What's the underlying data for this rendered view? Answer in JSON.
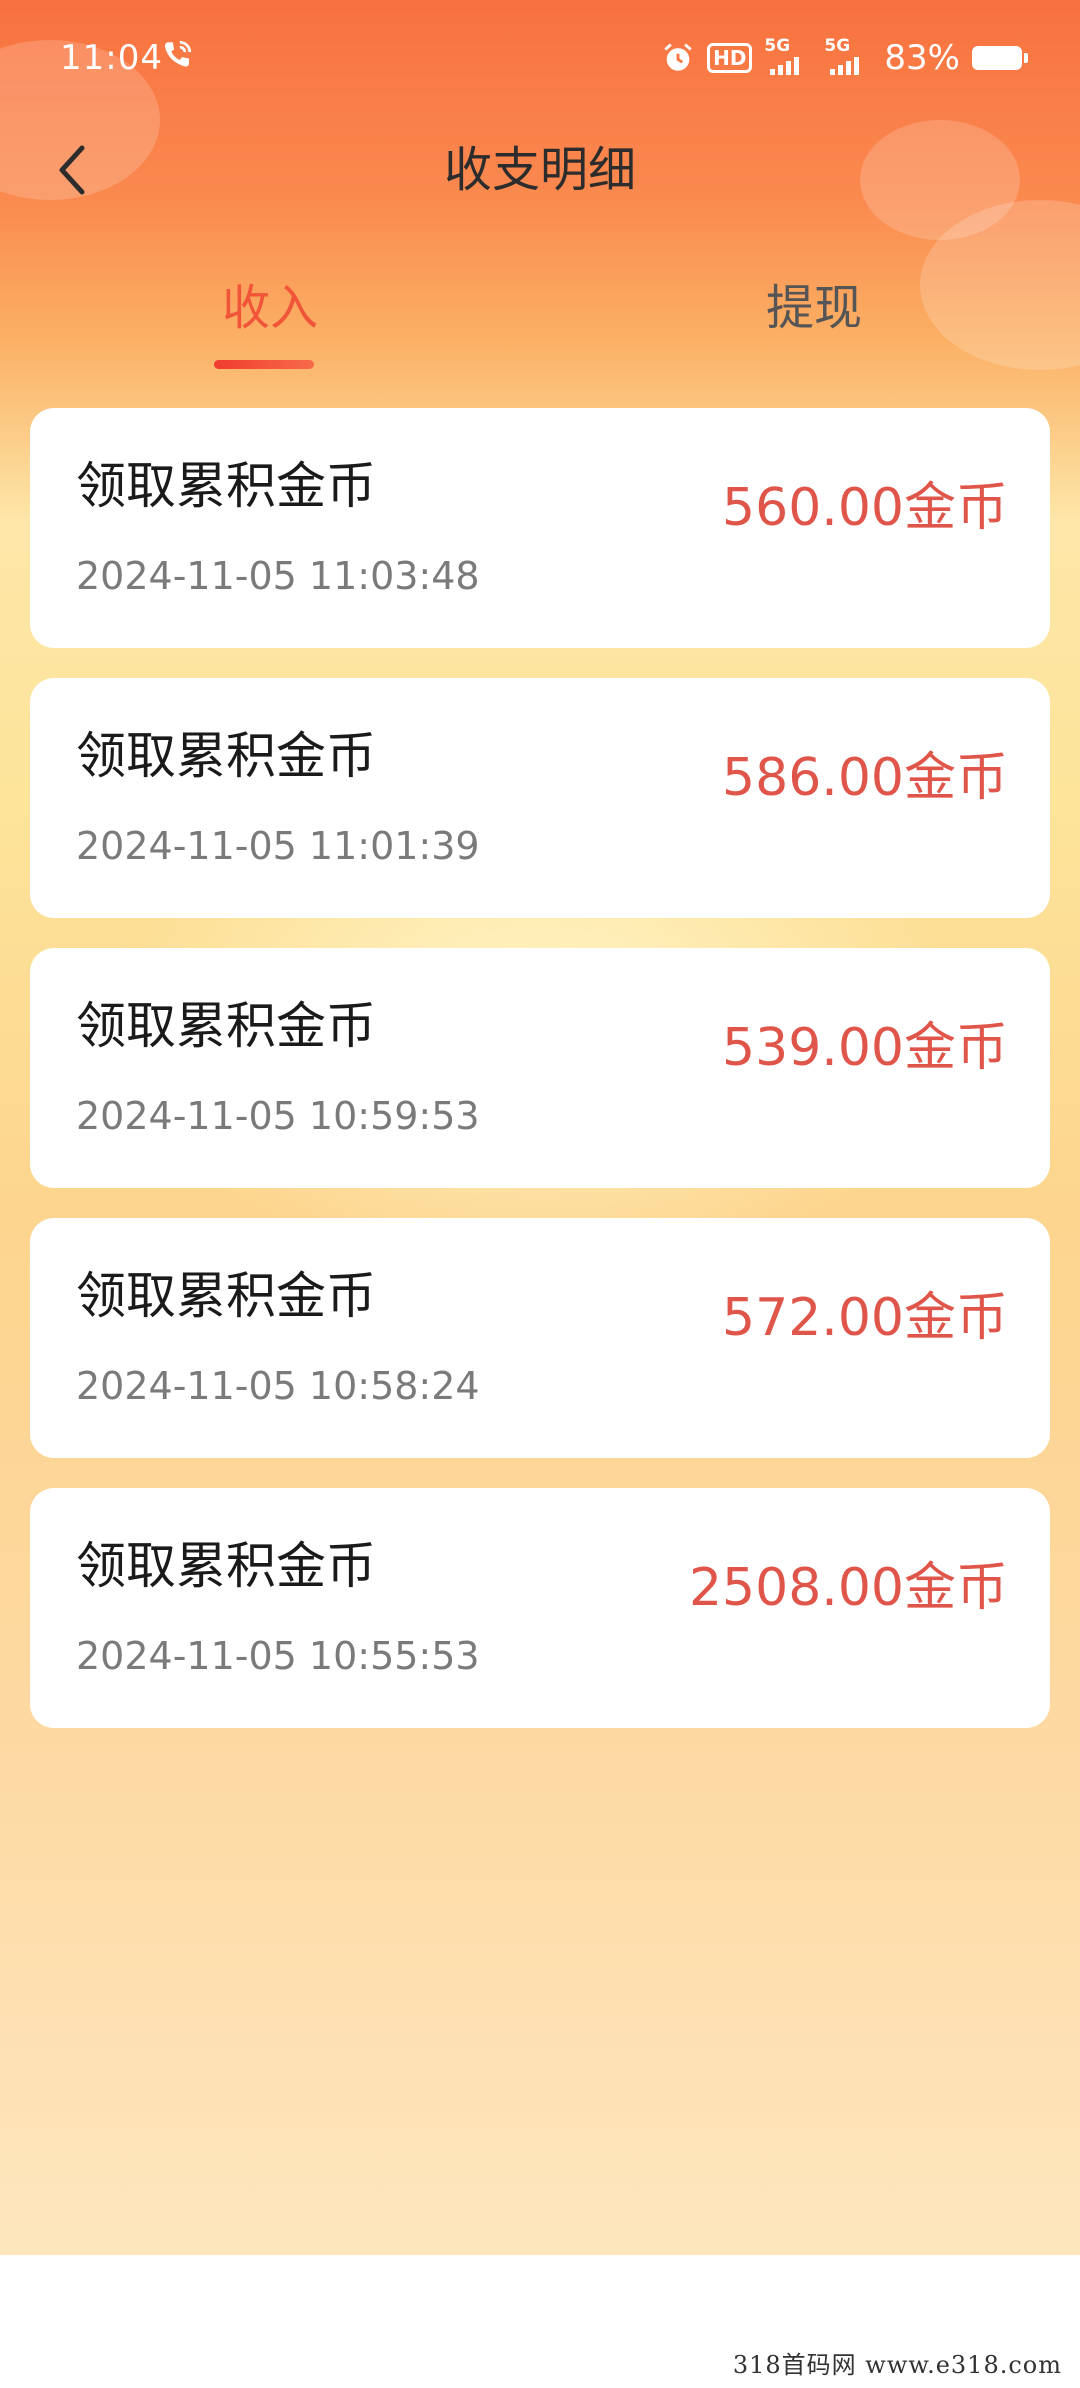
{
  "status_bar": {
    "time": "11:04",
    "hd": "HD",
    "network1": "5G",
    "network2": "5G",
    "battery": "83%"
  },
  "nav": {
    "title": "收支明细",
    "back_icon": "chevron-left-icon"
  },
  "tabs": [
    {
      "label": "收入",
      "active": true
    },
    {
      "label": "提现",
      "active": false
    }
  ],
  "records": [
    {
      "title": "领取累积金币",
      "time": "2024-11-05 11:03:48",
      "amount": "560.00金币"
    },
    {
      "title": "领取累积金币",
      "time": "2024-11-05 11:01:39",
      "amount": "586.00金币"
    },
    {
      "title": "领取累积金币",
      "time": "2024-11-05 10:59:53",
      "amount": "539.00金币"
    },
    {
      "title": "领取累积金币",
      "time": "2024-11-05 10:58:24",
      "amount": "572.00金币"
    },
    {
      "title": "领取累积金币",
      "time": "2024-11-05 10:55:53",
      "amount": "2508.00金币"
    }
  ],
  "watermark": "318首码网  www.e318.com",
  "colors": {
    "header_orange": "#f8713f",
    "active_tab": "#f0553a",
    "amount_red": "#e0554a"
  }
}
